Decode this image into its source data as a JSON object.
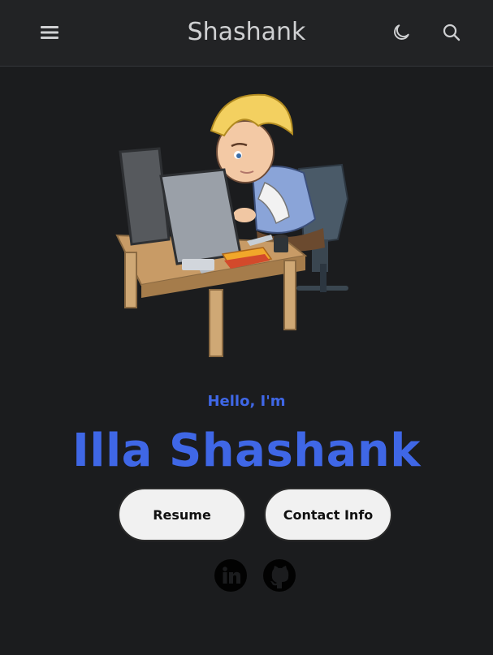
{
  "header": {
    "title": "Shashank",
    "menu_icon": "hamburger-menu-icon",
    "theme_icon": "moon-icon",
    "search_icon": "search-icon"
  },
  "hero": {
    "illustration": "developer-at-desk-illustration",
    "greeting": "Hello, I'm",
    "name": "Illa Shashank"
  },
  "actions": {
    "resume_label": "Resume",
    "contact_label": "Contact Info"
  },
  "social": [
    {
      "icon": "linkedin-icon"
    },
    {
      "icon": "github-icon"
    }
  ],
  "colors": {
    "background": "#1b1c1e",
    "header": "#222325",
    "accent": "#3f67e6",
    "button": "#f1f1f1"
  }
}
